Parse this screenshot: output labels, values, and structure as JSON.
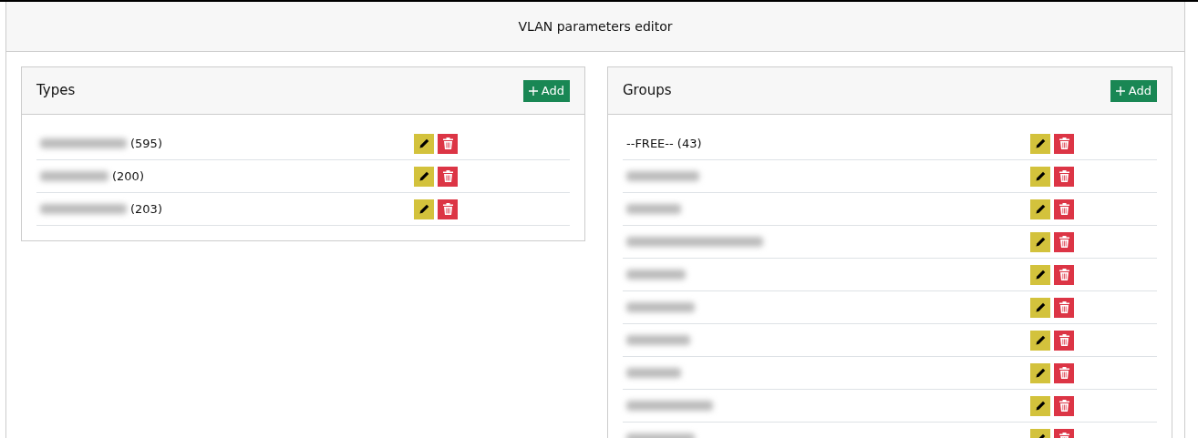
{
  "title": "VLAN parameters editor",
  "panels": [
    {
      "title": "Types",
      "add_button": "Add",
      "items": [
        {
          "kind": "redacted",
          "count": "(595)"
        },
        {
          "kind": "redacted",
          "count": "(200)"
        },
        {
          "kind": "redacted",
          "count": "(203)"
        }
      ]
    },
    {
      "title": "Groups",
      "add_button": "Add",
      "items": [
        {
          "kind": "plain",
          "label": "--FREE-- (43)"
        },
        {
          "kind": "redacted"
        },
        {
          "kind": "redacted"
        },
        {
          "kind": "redacted"
        },
        {
          "kind": "redacted"
        },
        {
          "kind": "redacted"
        },
        {
          "kind": "redacted"
        },
        {
          "kind": "redacted"
        },
        {
          "kind": "redacted"
        },
        {
          "kind": "redacted"
        }
      ]
    }
  ]
}
